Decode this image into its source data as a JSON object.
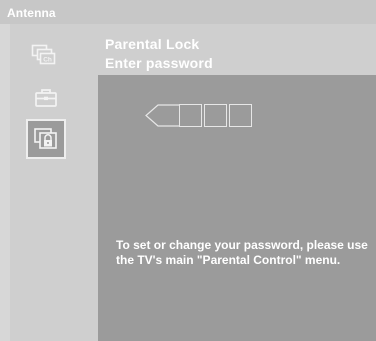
{
  "header": {
    "title": "Antenna"
  },
  "sidebar": {
    "items": [
      {
        "icon": "channel-ch-icon",
        "label": "Ch",
        "selected": false
      },
      {
        "icon": "toolbox-icon",
        "selected": false
      },
      {
        "icon": "parental-lock-icon",
        "selected": true
      }
    ]
  },
  "main": {
    "title": "Parental Lock",
    "subtitle": "Enter password",
    "password": {
      "digits_entered": 0,
      "max_digits": 4
    },
    "message": "To set or change your password, please use the TV's main \"Parental Control\" menu."
  },
  "colors": {
    "background": "#d7d7d7",
    "panel": "#9b9b9b",
    "header": "#c7c7c7",
    "text": "#ffffff"
  }
}
